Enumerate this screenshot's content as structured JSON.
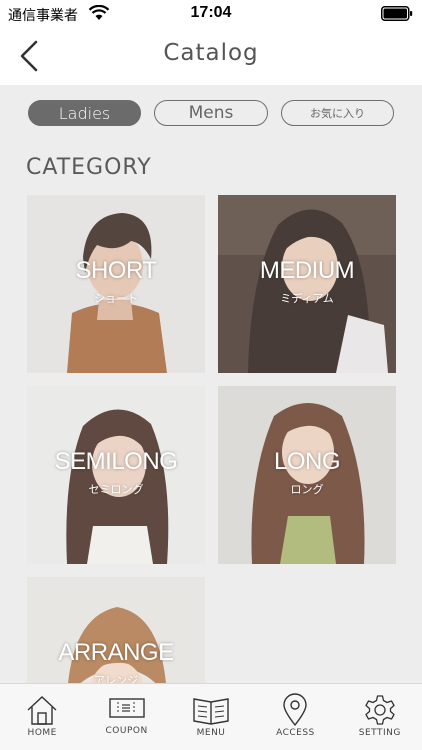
{
  "status_bar": {
    "carrier": "通信事業者",
    "time": "17:04"
  },
  "nav": {
    "title": "Catalog"
  },
  "segments": [
    {
      "label": "Ladies",
      "active": true
    },
    {
      "label": "Mens",
      "active": false
    },
    {
      "label": "お気に入り",
      "active": false
    }
  ],
  "category_heading": "CATEGORY",
  "categories": [
    {
      "en": "SHORT",
      "jp": "ショート"
    },
    {
      "en": "MEDIUM",
      "jp": "ミディアム"
    },
    {
      "en": "SEMILONG",
      "jp": "セミロング"
    },
    {
      "en": "LONG",
      "jp": "ロング"
    },
    {
      "en": "ARRANGE",
      "jp": "アレンジ"
    }
  ],
  "tabs": [
    {
      "label": "HOME",
      "icon": "home-icon"
    },
    {
      "label": "COUPON",
      "icon": "coupon-icon"
    },
    {
      "label": "MENU",
      "icon": "book-icon"
    },
    {
      "label": "ACCESS",
      "icon": "map-pin-icon"
    },
    {
      "label": "SETTING",
      "icon": "gear-icon"
    }
  ],
  "colors": {
    "segment_active_bg": "#6b6b6b",
    "content_bg": "#ededed",
    "tab_bar_bg": "#f7f7f7"
  }
}
